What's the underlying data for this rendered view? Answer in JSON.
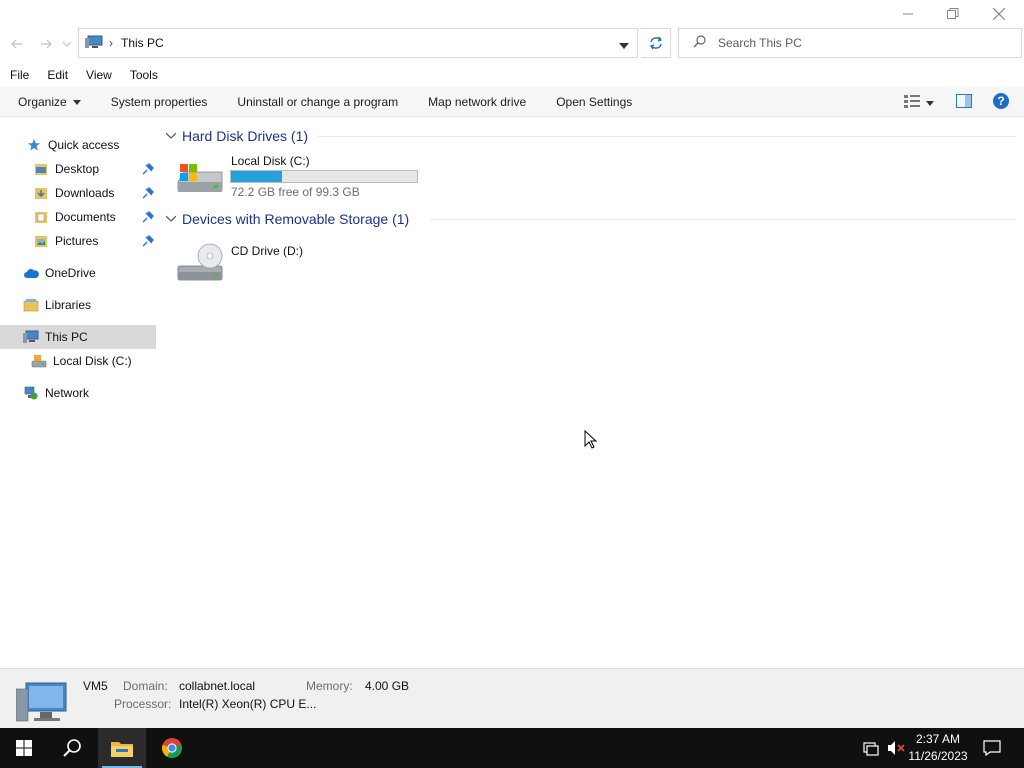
{
  "window": {
    "minimize_label": "minimize",
    "restore_label": "restore",
    "close_label": "close"
  },
  "address_bar": {
    "path": "This PC"
  },
  "search": {
    "placeholder": "Search This PC"
  },
  "menu": [
    "File",
    "Edit",
    "View",
    "Tools"
  ],
  "commands": {
    "organize": "Organize",
    "system_properties": "System properties",
    "uninstall": "Uninstall or change a program",
    "map_drive": "Map network drive",
    "open_settings": "Open Settings"
  },
  "nav": {
    "quick_access": "Quick access",
    "desktop": "Desktop",
    "downloads": "Downloads",
    "documents": "Documents",
    "pictures": "Pictures",
    "onedrive": "OneDrive",
    "libraries": "Libraries",
    "this_pc": "This PC",
    "local_disk": "Local Disk (C:)",
    "network": "Network"
  },
  "groups": {
    "hdd": {
      "title": "Hard Disk Drives (1)",
      "drive_name": "Local Disk (C:)",
      "free_text": "72.2 GB free of 99.3 GB",
      "used_fraction": 0.273
    },
    "removable": {
      "title": "Devices with Removable Storage (1)",
      "drive_name": "CD Drive (D:)"
    }
  },
  "details": {
    "computer_name": "VM5",
    "domain_label": "Domain:",
    "domain_value": "collabnet.local",
    "memory_label": "Memory:",
    "memory_value": "4.00 GB",
    "processor_label": "Processor:",
    "processor_value": "Intel(R) Xeon(R) CPU E..."
  },
  "taskbar": {
    "time": "2:37 AM",
    "date": "11/26/2023"
  },
  "colors": {
    "accent": "#26a0da",
    "group_header": "#1e3287",
    "taskbar": "#101010",
    "selected": "#d9d9d9"
  }
}
